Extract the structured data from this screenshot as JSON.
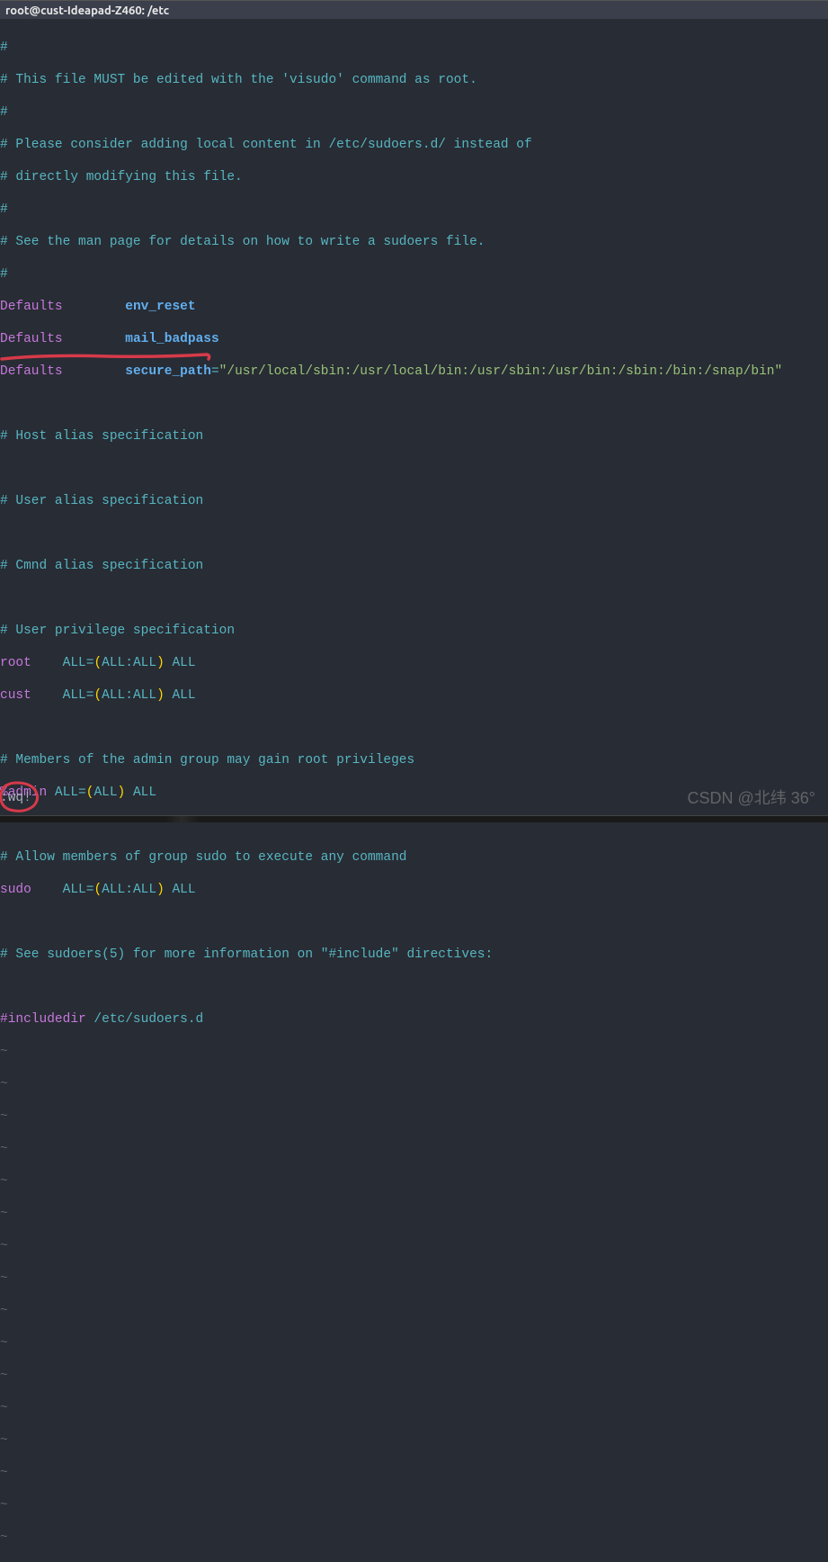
{
  "title": "root@cust-Ideapad-Z460: /etc",
  "lines": {
    "c1": "#",
    "c2": "# This file MUST be edited with the 'visudo' command as root.",
    "c3": "#",
    "c4": "# Please consider adding local content in /etc/sudoers.d/ instead of",
    "c5": "# directly modifying this file.",
    "c6": "#",
    "c7": "# See the man page for details on how to write a sudoers file.",
    "c8": "#",
    "d1_kw": "Defaults",
    "d1_id": "env_reset",
    "d2_kw": "Defaults",
    "d2_id": "mail_badpass",
    "d3_kw": "Defaults",
    "d3_id": "secure_path",
    "d3_eq": "=",
    "d3_str": "\"/usr/local/sbin:/usr/local/bin:/usr/sbin:/usr/bin:/sbin:/bin:/snap/bin\"",
    "c9": "# Host alias specification",
    "c10": "# User alias specification",
    "c11": "# Cmnd alias specification",
    "c12": "# User privilege specification",
    "root_user": "root",
    "root_all1": "ALL",
    "root_eq": "=",
    "root_lp": "(",
    "root_all2": "ALL",
    "root_colon": ":",
    "root_all3": "ALL",
    "root_rp": ")",
    "root_all4": " ALL",
    "cust_user": "cust",
    "cust_all1": "ALL",
    "cust_eq": "=",
    "cust_lp": "(",
    "cust_all2": "ALL",
    "cust_colon": ":",
    "cust_all3": "ALL",
    "cust_rp": ")",
    "cust_all4": " ALL",
    "c13": "# Members of the admin group may gain root privileges",
    "admin_user": "%admin",
    "admin_all1": " ALL",
    "admin_eq": "=",
    "admin_lp": "(",
    "admin_all2": "ALL",
    "admin_rp": ")",
    "admin_all3": " ALL",
    "c14": "# Allow members of group sudo to execute any command",
    "sudo_user": "sudo",
    "sudo_all1": "ALL",
    "sudo_eq": "=",
    "sudo_lp": "(",
    "sudo_all2": "ALL",
    "sudo_colon": ":",
    "sudo_all3": "ALL",
    "sudo_rp": ")",
    "sudo_all4": " ALL",
    "c15": "# See sudoers(5) for more information on \"#include\" directives:",
    "incl_dir": "#includedir",
    "incl_path": " /etc/sudoers.d",
    "tilde": "~"
  },
  "command": ":wq!",
  "watermark": "CSDN @北纬  36°"
}
